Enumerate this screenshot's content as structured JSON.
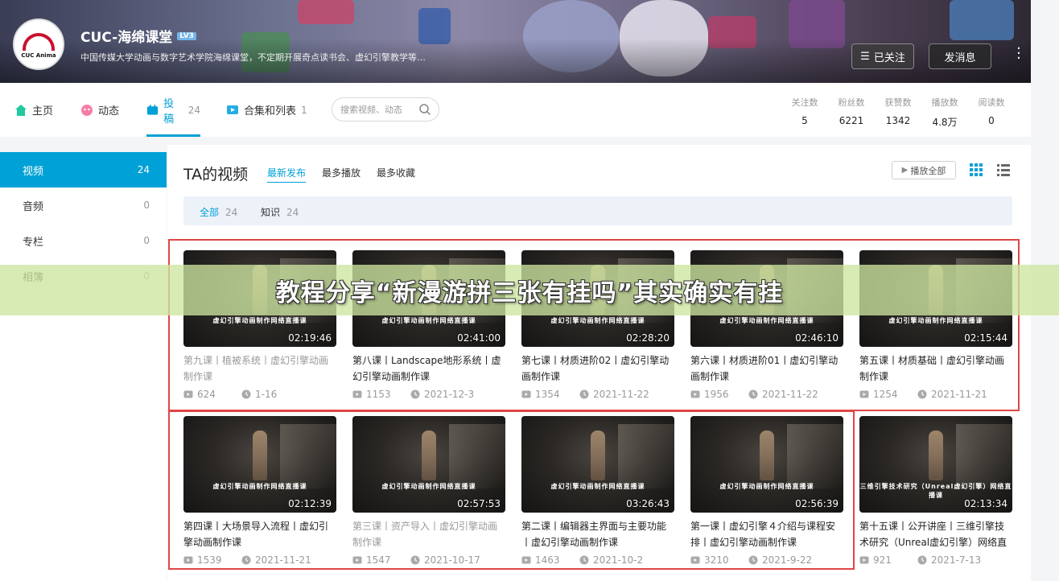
{
  "header": {
    "username": "CUC-海绵课堂",
    "level": "LV3",
    "signature": "中国传媒大学动画与数字艺术学院海绵课堂，不定期开展奇点读书会、虚幻引擎教学等…",
    "logo_text": "CUC Anima",
    "follow_label": "已关注",
    "message_label": "发消息"
  },
  "nav": {
    "items": [
      {
        "label": "主页",
        "count": ""
      },
      {
        "label": "动态",
        "count": ""
      },
      {
        "label": "投稿",
        "count": "24"
      },
      {
        "label": "合集和列表",
        "count": "1"
      }
    ],
    "search_placeholder": "搜索视频、动态",
    "stats": [
      {
        "label": "关注数",
        "value": "5"
      },
      {
        "label": "粉丝数",
        "value": "6221"
      },
      {
        "label": "获赞数",
        "value": "1342"
      },
      {
        "label": "播放数",
        "value": "4.8万"
      },
      {
        "label": "阅读数",
        "value": "0"
      }
    ]
  },
  "sidebar": {
    "items": [
      {
        "label": "视频",
        "count": "24"
      },
      {
        "label": "音频",
        "count": "0"
      },
      {
        "label": "专栏",
        "count": "0"
      },
      {
        "label": "相簿",
        "count": "0"
      }
    ]
  },
  "main": {
    "title": "TA的视频",
    "sorts": [
      "最新发布",
      "最多播放",
      "最多收藏"
    ],
    "play_all": "播放全部",
    "filters": [
      {
        "label": "全部",
        "count": "24"
      },
      {
        "label": "知识",
        "count": "24"
      }
    ]
  },
  "videos": [
    {
      "title": "第九课丨植被系统丨虚幻引擎动画制作课",
      "duration": "02:19:46",
      "plays": "624",
      "date": "1-16",
      "caption": "虚幻引擎动画制作网络直播课"
    },
    {
      "title": "第八课丨Landscape地形系统丨虚幻引擎动画制作课",
      "duration": "02:41:00",
      "plays": "1153",
      "date": "2021-12-3",
      "caption": "虚幻引擎动画制作网络直播课"
    },
    {
      "title": "第七课丨材质进阶02丨虚幻引擎动画制作课",
      "duration": "02:28:20",
      "plays": "1354",
      "date": "2021-11-22",
      "caption": "虚幻引擎动画制作网络直播课"
    },
    {
      "title": "第六课丨材质进阶01丨虚幻引擎动画制作课",
      "duration": "02:46:10",
      "plays": "1956",
      "date": "2021-11-22",
      "caption": "虚幻引擎动画制作网络直播课"
    },
    {
      "title": "第五课丨材质基础丨虚幻引擎动画制作课",
      "duration": "02:15:44",
      "plays": "1254",
      "date": "2021-11-21",
      "caption": "虚幻引擎动画制作网络直播课"
    },
    {
      "title": "第四课丨大场景导入流程丨虚幻引擎动画制作课",
      "duration": "02:12:39",
      "plays": "1539",
      "date": "2021-11-21",
      "caption": "虚幻引擎动画制作网络直播课"
    },
    {
      "title": "第三课丨资产导入丨虚幻引擎动画制作课",
      "duration": "02:57:53",
      "plays": "1547",
      "date": "2021-10-17",
      "caption": "虚幻引擎动画制作网络直播课"
    },
    {
      "title": "第二课丨编辑器主界面与主要功能丨虚幻引擎动画制作课",
      "duration": "03:26:43",
      "plays": "1463",
      "date": "2021-10-2",
      "caption": "虚幻引擎动画制作网络直播课"
    },
    {
      "title": "第一课丨虚幻引擎４介绍与课程安排丨虚幻引擎动画制作课",
      "duration": "02:56:39",
      "plays": "3210",
      "date": "2021-9-22",
      "caption": "虚幻引擎动画制作网络直播课"
    },
    {
      "title": "第十五课丨公开讲座丨三维引擎技术研究（Unreal虚幻引擎）网络直",
      "duration": "02:13:34",
      "plays": "921",
      "date": "2021-7-13",
      "caption": "三维引擎技术研究（Unreal虚幻引擎）网络直播课"
    }
  ],
  "overlay_text": "教程分享“新漫游拼三张有挂吗”其实确实有挂",
  "colors": {
    "accent": "#00a1d6",
    "highlight_box": "#e04545",
    "overlay": "#cde6a0"
  }
}
